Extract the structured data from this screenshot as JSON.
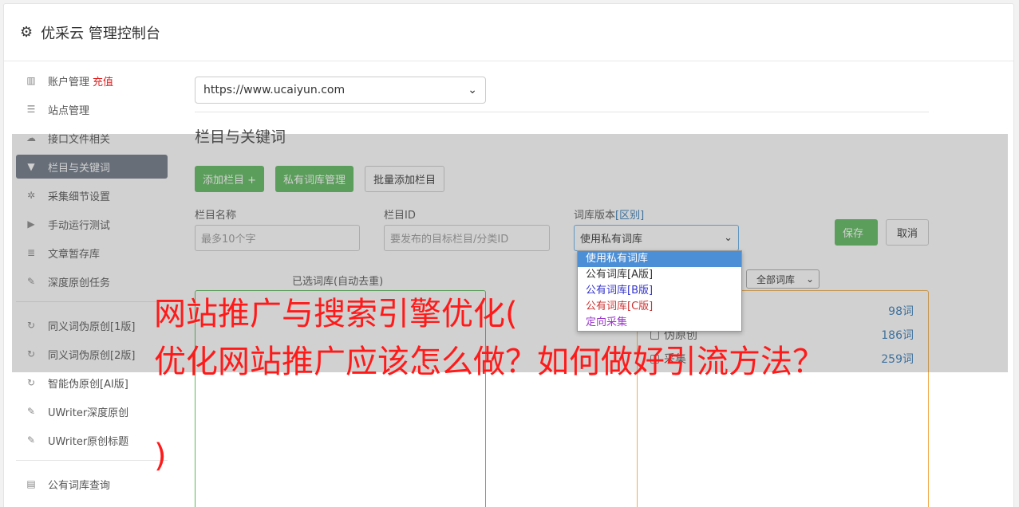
{
  "header": {
    "title": "优采云 管理控制台"
  },
  "sidebar": {
    "items": [
      {
        "icon": "bar-chart-icon",
        "label": "账户管理",
        "badge": "充值"
      },
      {
        "icon": "server-icon",
        "label": "站点管理"
      },
      {
        "icon": "cloud-upload-icon",
        "label": "接口文件相关"
      },
      {
        "icon": "filter-icon",
        "label": "栏目与关键词",
        "active": true
      },
      {
        "icon": "cogs-icon",
        "label": "采集细节设置"
      },
      {
        "icon": "play-circle-icon",
        "label": "手动运行测试"
      },
      {
        "icon": "database-icon",
        "label": "文章暂存库"
      },
      {
        "icon": "edit-icon",
        "label": "深度原创任务"
      },
      {
        "icon": "refresh-icon",
        "label": "同义词伪原创[1版]"
      },
      {
        "icon": "refresh-icon",
        "label": "同义词伪原创[2版]"
      },
      {
        "icon": "refresh-icon",
        "label": "智能伪原创[AI版]"
      },
      {
        "icon": "edit-icon",
        "label": "UWriter深度原创"
      },
      {
        "icon": "edit-icon",
        "label": "UWriter原创标题"
      },
      {
        "icon": "book-icon",
        "label": "公有词库查询"
      }
    ]
  },
  "main": {
    "site_select": "https://www.ucaiyun.com",
    "section_title": "栏目与关键词",
    "buttons": {
      "add_column": "添加栏目 +",
      "private_lib": "私有词库管理",
      "batch_add": "批量添加栏目"
    },
    "form": {
      "column_name_label": "栏目名称",
      "column_name_placeholder": "最多10个字",
      "column_id_label": "栏目ID",
      "column_id_placeholder": "要发布的目标栏目/分类ID",
      "lib_version_label": "词库版本",
      "lib_version_link": "[区别]",
      "lib_version_value": "使用私有词库",
      "save": "保存",
      "cancel": "取消"
    },
    "selected_lib_label": "已选词库(自动去重)",
    "all_lib_filter": "全部词库",
    "lib_rows": [
      {
        "name": "",
        "count": "98词"
      },
      {
        "name": "伪原创",
        "count": "186词"
      },
      {
        "name": "采集",
        "count": "259词"
      }
    ],
    "dropdown_options": [
      {
        "label": "使用私有词库",
        "color": "#ffffff"
      },
      {
        "label": "公有词库[A版]",
        "color": "#333333"
      },
      {
        "label": "公有词库[B版]",
        "color": "#3333cc"
      },
      {
        "label": "公有词库[C版]",
        "color": "#cc3333"
      },
      {
        "label": "定向采集",
        "color": "#9933cc"
      }
    ]
  },
  "overlay_text": {
    "line1": "网站推广与搜索引擎优化(",
    "line2": "优化网站推广应该怎么做？如何做好引流方法？",
    "line3": ")"
  }
}
